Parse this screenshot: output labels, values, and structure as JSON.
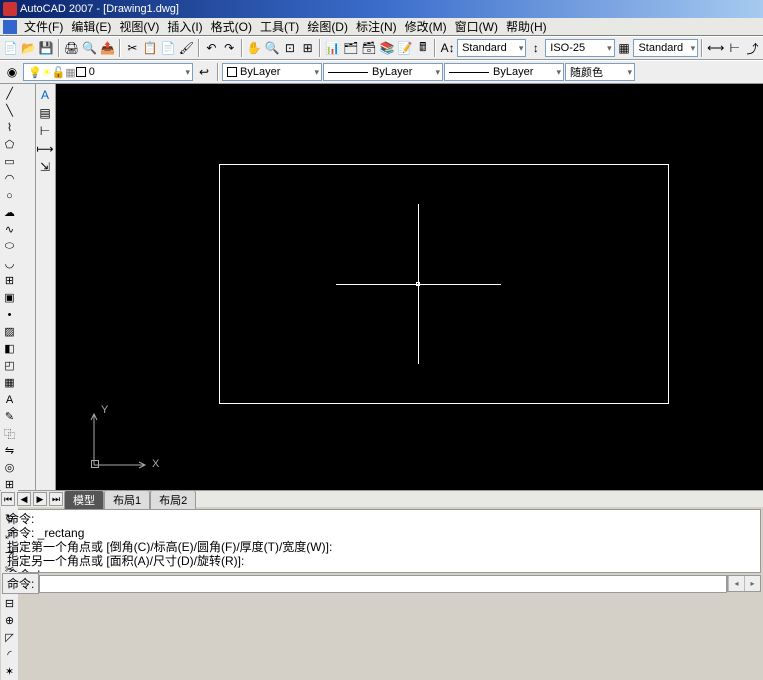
{
  "title": "AutoCAD 2007 - [Drawing1.dwg]",
  "menu": {
    "file": "文件(F)",
    "edit": "编辑(E)",
    "view": "视图(V)",
    "insert": "插入(I)",
    "format": "格式(O)",
    "tools": "工具(T)",
    "draw": "绘图(D)",
    "dim": "标注(N)",
    "modify": "修改(M)",
    "window": "窗口(W)",
    "help": "帮助(H)"
  },
  "props": {
    "text_style": "Standard",
    "dim_style": "ISO-25",
    "table_style": "Standard",
    "layer": "0",
    "bylayer": "ByLayer",
    "color": "随颜色"
  },
  "tabs": {
    "model": "模型",
    "layout1": "布局1",
    "layout2": "布局2"
  },
  "ucs": {
    "x": "X",
    "y": "Y"
  },
  "cmdlog": "命令:\n命令: _rectang\n指定第一个角点或 [倒角(C)/标高(E)/圆角(F)/厚度(T)/宽度(W)]:\n指定另一个角点或 [面积(A)/尺寸(D)/旋转(R)]:\n命令: '_.zoom _e\n命令: '_.zoom _e",
  "cmdprompt": "命令:"
}
